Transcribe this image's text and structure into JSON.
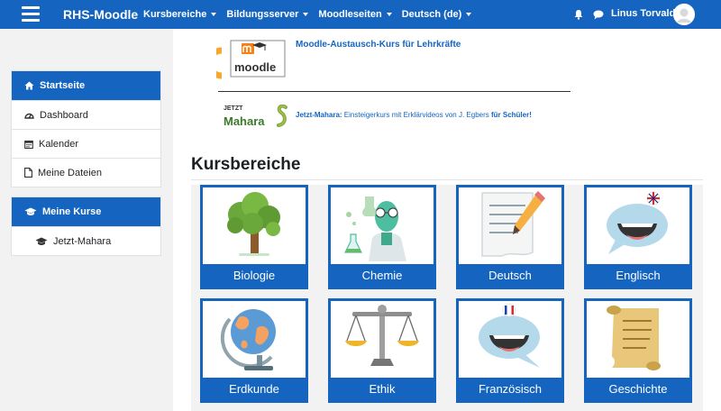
{
  "brand": "RHS-Moodle",
  "navbar": {
    "menus": [
      {
        "label": "Kursbereiche"
      },
      {
        "label": "Bildungsserver"
      },
      {
        "label": "Moodleseiten"
      },
      {
        "label": "Deutsch (de)"
      }
    ],
    "user_name": "Linus Torvalds"
  },
  "sidebar": {
    "nav": [
      {
        "label": "Startseite",
        "icon": "home-icon"
      },
      {
        "label": "Dashboard",
        "icon": "dashboard-icon"
      },
      {
        "label": "Kalender",
        "icon": "calendar-icon"
      },
      {
        "label": "Meine Dateien",
        "icon": "file-icon"
      }
    ],
    "courses": {
      "title": "Meine Kurse",
      "items": [
        {
          "label": "Jetzt-Mahara",
          "icon": "graduation-cap-icon"
        }
      ]
    }
  },
  "main": {
    "promo1": {
      "logo_text": "moodle",
      "link": "Moodle-Austausch-Kurs für Lehrkräfte"
    },
    "promo2": {
      "logo_small": "JETZT",
      "logo_word": "Mahara",
      "link_bold": "Jetzt-Mahara:",
      "text": " Einsteigerkurs mit Erklärvideos von J. Egbers ",
      "text_bold": "für Schüler!"
    },
    "section_title": "Kursbereiche",
    "categories": [
      {
        "label": "Biologie",
        "icon": "tree-icon"
      },
      {
        "label": "Chemie",
        "icon": "scientist-icon"
      },
      {
        "label": "Deutsch",
        "icon": "paper-pencil-icon"
      },
      {
        "label": "Englisch",
        "icon": "speech-bubble-uk-icon"
      },
      {
        "label": "Erdkunde",
        "icon": "globe-icon"
      },
      {
        "label": "Ethik",
        "icon": "scales-icon"
      },
      {
        "label": "Französisch",
        "icon": "speech-bubble-france-icon"
      },
      {
        "label": "Geschichte",
        "icon": "scroll-icon"
      }
    ]
  },
  "colors": {
    "primary": "#1565c0",
    "drawer_bg": "#f2f2f2"
  }
}
